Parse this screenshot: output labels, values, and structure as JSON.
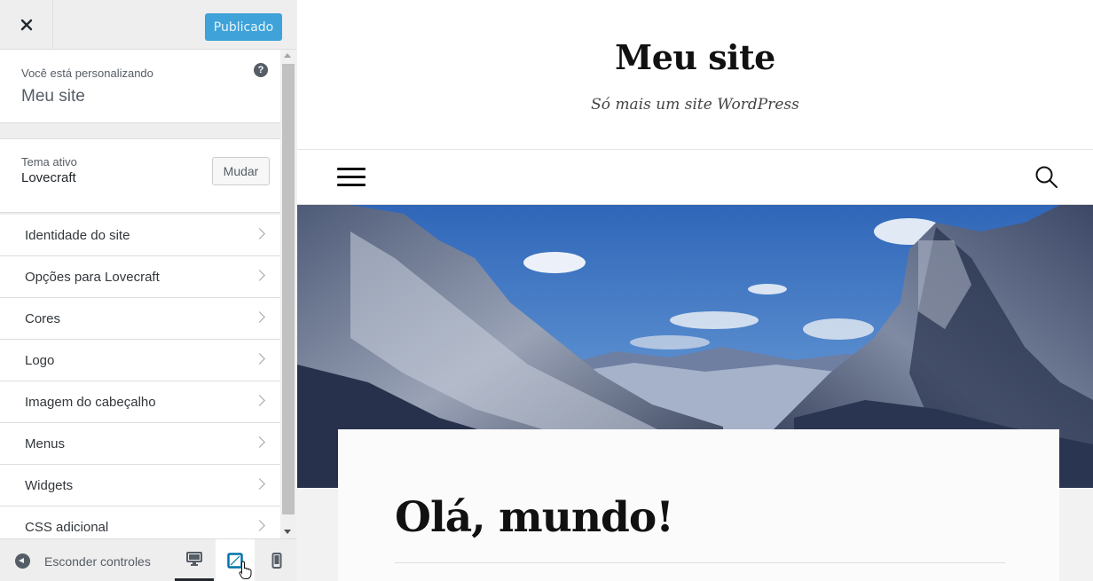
{
  "sidebar": {
    "close_icon": "close-icon",
    "publish_label": "Publicado",
    "customizing_label": "Você está personalizando",
    "site_name": "Meu site",
    "help_icon": "help-icon",
    "theme_label": "Tema ativo",
    "theme_name": "Lovecraft",
    "change_label": "Mudar",
    "sections": [
      {
        "label": "Identidade do site"
      },
      {
        "label": "Opções para Lovecraft"
      },
      {
        "label": "Cores"
      },
      {
        "label": "Logo"
      },
      {
        "label": "Imagem do cabeçalho"
      },
      {
        "label": "Menus"
      },
      {
        "label": "Widgets"
      },
      {
        "label": "CSS adicional"
      }
    ],
    "collapse_label": "Esconder controles",
    "devices": [
      "desktop",
      "tablet",
      "mobile"
    ],
    "active_device": "tablet"
  },
  "preview": {
    "site_title": "Meu site",
    "tagline": "Só mais um site WordPress",
    "post_title": "Olá, mundo!"
  },
  "colors": {
    "publish_button": "#3fa2d8",
    "sidebar_bg": "#eeeeee",
    "text_dark": "#23282d"
  }
}
